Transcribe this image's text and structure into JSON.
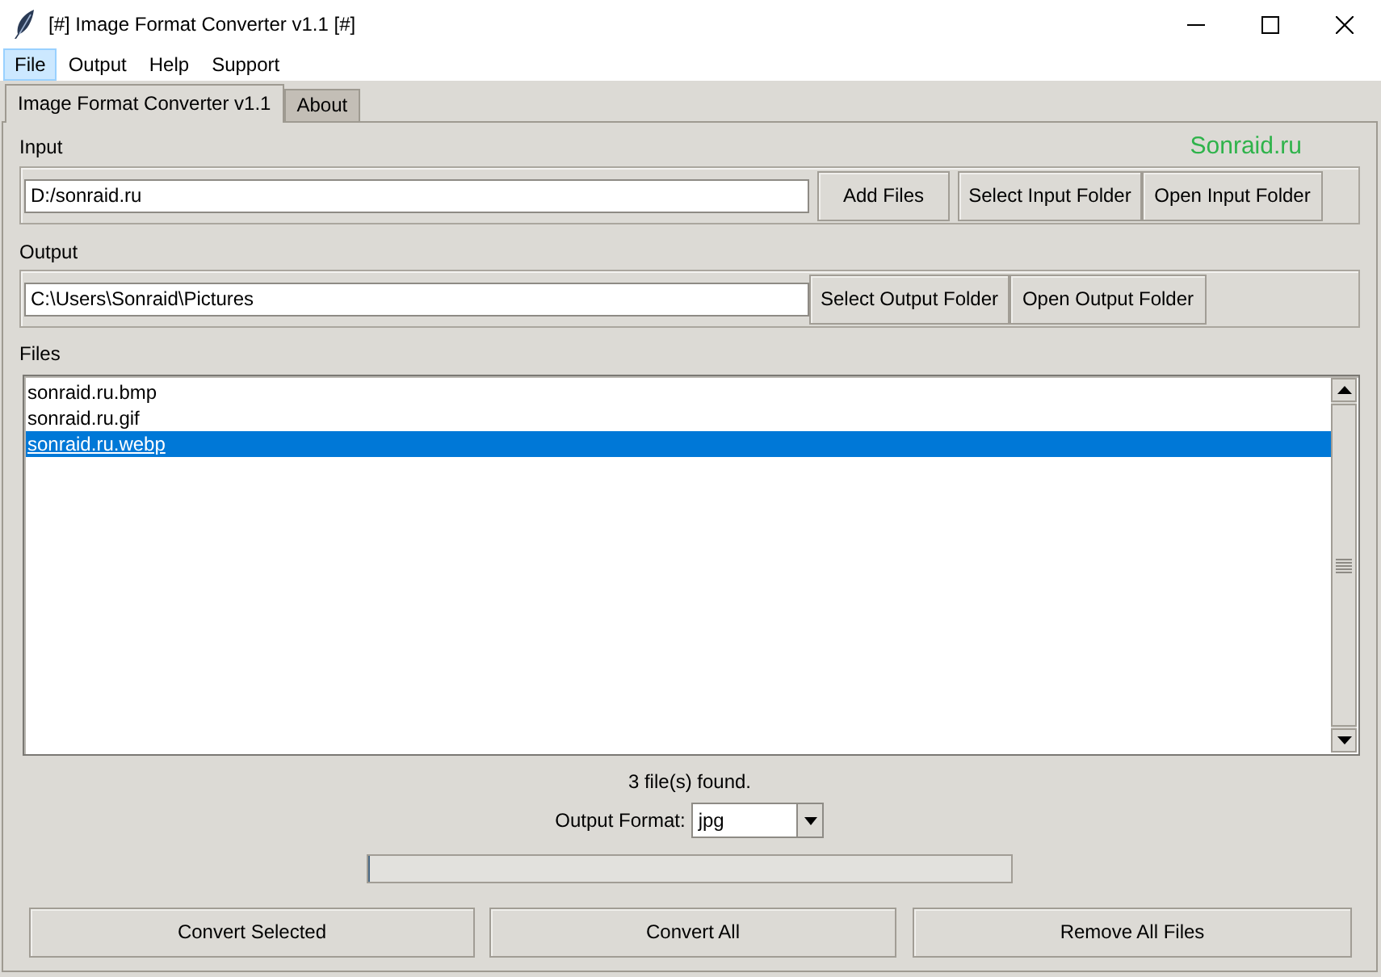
{
  "window": {
    "title": "[#] Image Format Converter v1.1 [#]"
  },
  "menu": [
    {
      "label": "File",
      "selected": true
    },
    {
      "label": "Output",
      "selected": false
    },
    {
      "label": "Help",
      "selected": false
    },
    {
      "label": "Support",
      "selected": false
    }
  ],
  "tabs": [
    {
      "label": "Image Format Converter v1.1",
      "selected": true
    },
    {
      "label": "About",
      "selected": false
    }
  ],
  "brand": "Sonraid.ru",
  "input": {
    "label": "Input",
    "value": "D:/sonraid.ru",
    "buttons": [
      "Add Files",
      "Select Input Folder",
      "Open Input Folder"
    ]
  },
  "output": {
    "label": "Output",
    "value": "C:\\Users\\Sonraid\\Pictures",
    "buttons": [
      "Select Output Folder",
      "Open Output Folder"
    ]
  },
  "files": {
    "label": "Files",
    "items": [
      {
        "name": "sonraid.ru.bmp",
        "selected": false
      },
      {
        "name": "sonraid.ru.gif",
        "selected": false
      },
      {
        "name": "sonraid.ru.webp",
        "selected": true
      }
    ]
  },
  "status": "3 file(s) found.",
  "format": {
    "label": "Output Format:",
    "value": "jpg"
  },
  "progress": {
    "level": 0
  },
  "actions": [
    "Convert Selected",
    "Convert All",
    "Remove All Files"
  ]
}
